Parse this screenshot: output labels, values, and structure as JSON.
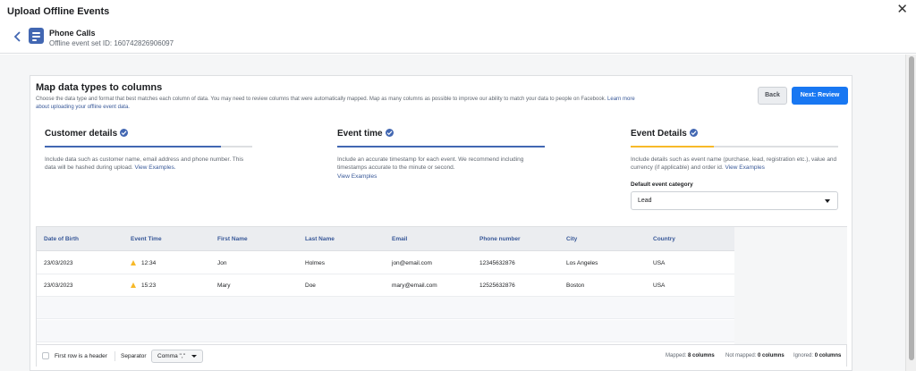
{
  "window": {
    "title": "Upload Offline Events"
  },
  "event_set": {
    "name": "Phone Calls",
    "id_text": "Offline event set ID: 160742826906097"
  },
  "card": {
    "title": "Map data types to columns",
    "description": "Choose the data type and format that best matches each column of data. You may need to review columns that were automatically mapped. Map as many columns as possible to improve our ability to match your data to people on Facebook.",
    "learn_more": "Learn more about uploading your offline event data."
  },
  "buttons": {
    "back": "Back",
    "next": "Next: Review"
  },
  "steps": [
    {
      "title": "Customer details",
      "description": "Include data such as customer name, email address and phone number. This data will be hashed during upload.",
      "link": "View Examples.",
      "progress": 0.85,
      "color": "#4267b2"
    },
    {
      "title": "Event time",
      "description": "Include an accurate timestamp for each event. We recommend including timestamps accurate to the minute or second.",
      "link": "View Examples",
      "progress": 1.0,
      "color": "#4267b2"
    },
    {
      "title": "Event Details",
      "description": "Include details such as event name (purchase, lead, registration etc.), value and currency (if applicable) and order id.",
      "link": "View Examples",
      "progress": 0.4,
      "color": "#f7b928"
    }
  ],
  "event_category": {
    "label": "Default event category",
    "value": "Lead"
  },
  "table": {
    "columns": [
      "Date of Birth",
      "Event Time",
      "First Name",
      "Last Name",
      "Email",
      "Phone number",
      "City",
      "Country"
    ],
    "rows": [
      [
        "23/03/2023",
        "12:34",
        "Jon",
        "Holmes",
        "jon@email.com",
        "12345632876",
        "Los Angeles",
        "USA"
      ],
      [
        "23/03/2023",
        "15:23",
        "Mary",
        "Doe",
        "mary@email.com",
        "12525632876",
        "Boston",
        "USA"
      ]
    ],
    "warning_column": 1
  },
  "footer": {
    "first_row_header": "First row is a header",
    "separator_label": "Separator",
    "separator_value": "Comma \",\"",
    "mapped_label": "Mapped:",
    "mapped_value": "8 columns",
    "not_mapped_label": "Not mapped:",
    "not_mapped_value": "0 columns",
    "ignored_label": "Ignored:",
    "ignored_value": "0 columns"
  },
  "icons": {
    "close": "close-icon",
    "back": "chevron-left-icon",
    "event_set": "event-set-icon",
    "check": "check-circle-icon",
    "warning": "warning-icon",
    "dropdown": "caret-down-icon"
  },
  "colors": {
    "accent": "#1877f2",
    "link": "#385898",
    "warning": "#f7b928"
  }
}
